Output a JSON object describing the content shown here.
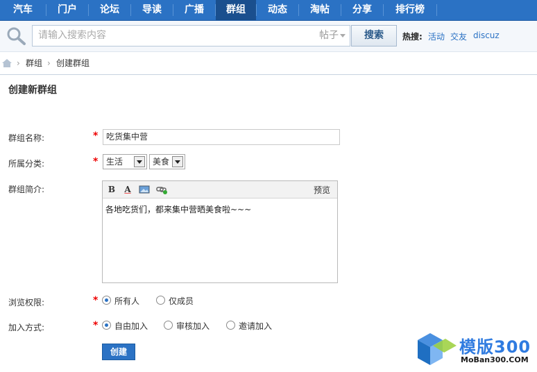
{
  "nav": {
    "items": [
      "汽车",
      "门户",
      "论坛",
      "导读",
      "广播",
      "群组",
      "动态",
      "淘帖",
      "分享",
      "排行榜"
    ],
    "active": "群组"
  },
  "search": {
    "placeholder": "请输入搜索内容",
    "type": "帖子",
    "button": "搜索",
    "hot_label": "热搜:",
    "hot_links": [
      "活动",
      "交友",
      "discuz"
    ]
  },
  "breadcrumb": {
    "items": [
      "群组",
      "创建群组"
    ]
  },
  "form": {
    "title": "创建新群组",
    "name_label": "群组名称:",
    "name_value": "吃货集中营",
    "category_label": "所属分类:",
    "category_primary": "生活",
    "category_secondary": "美食",
    "intro_label": "群组简介:",
    "preview": "预览",
    "intro_text": "各地吃货们，都来集中营晒美食啦~~~",
    "browse_label": "浏览权限:",
    "browse_options": [
      "所有人",
      "仅成员"
    ],
    "browse_selected": "所有人",
    "join_label": "加入方式:",
    "join_options": [
      "自由加入",
      "审核加入",
      "邀请加入"
    ],
    "join_selected": "自由加入",
    "submit": "创建"
  },
  "watermark": {
    "title": "模版300",
    "sub": "MoBan300.COM"
  },
  "colors": {
    "brand": "#2b72c4",
    "active_nav": "#1a4f8e",
    "required": "#e00000"
  }
}
